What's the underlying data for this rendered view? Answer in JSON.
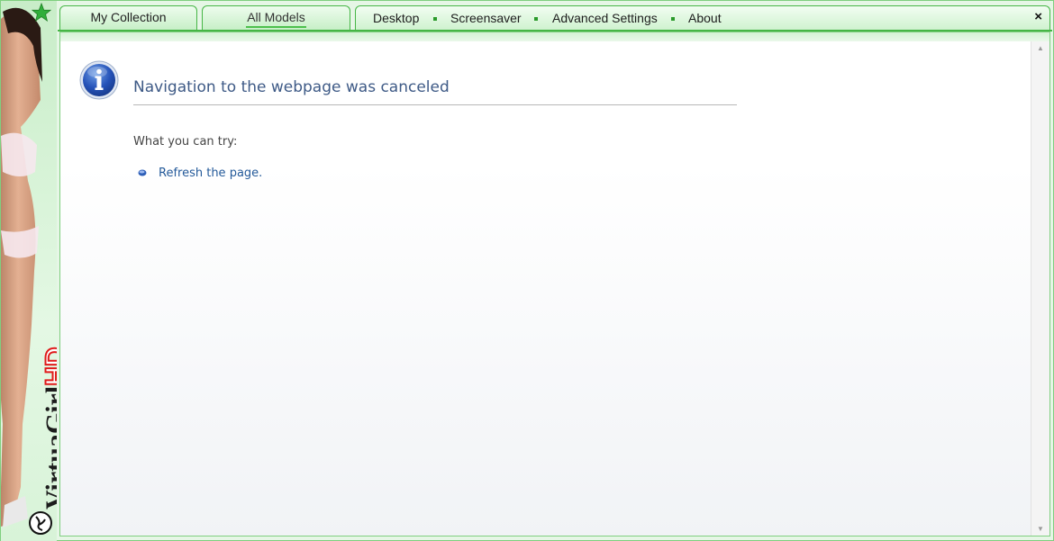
{
  "tabs": {
    "my_collection": "My Collection",
    "all_models": "All Models"
  },
  "menu": {
    "desktop": "Desktop",
    "screensaver": "Screensaver",
    "advanced_settings": "Advanced Settings",
    "about": "About",
    "close": "×"
  },
  "brand": {
    "name": "VirtuaGirl",
    "suffix": "HD"
  },
  "error_page": {
    "title": "Navigation to the webpage was canceled",
    "try_label": "What you can try:",
    "refresh_link": "Refresh the page."
  },
  "colors": {
    "accent_green": "#46b646",
    "title_blue": "#3e5a86",
    "link_blue": "#245a9a"
  },
  "icons": {
    "star": "star-icon",
    "info": "info-icon",
    "close": "close-icon",
    "bullet": "bullet-icon",
    "scroll_up": "scroll-up-arrow-icon",
    "scroll_down": "scroll-down-arrow-icon"
  }
}
